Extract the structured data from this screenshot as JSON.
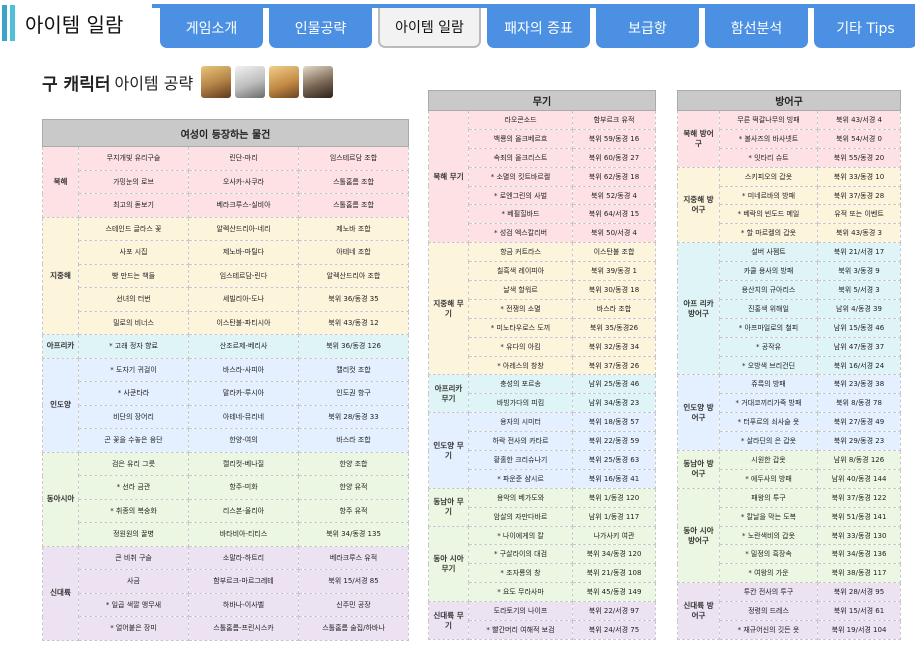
{
  "header": {
    "title": "아이템 일람"
  },
  "tabs": [
    "게임소개",
    "인물공략",
    "아이템 일람",
    "패자의 증표",
    "보급항",
    "함선분석",
    "기타 Tips"
  ],
  "active_tab": 2,
  "section": {
    "bold": "구 캐릭터",
    "normal": "아이템 공략"
  },
  "table1": {
    "header": "여성이 등장하는 물건",
    "groups": [
      {
        "cat": "북해",
        "color": "pink",
        "rows": [
          [
            "무지개빛 유리구슬",
            "린단-마리",
            "임스테르담 조합"
          ],
          [
            "가밍눈의 로브",
            "오사카-사쿠라",
            "스톨홈름 조합"
          ],
          [
            "최고의 돋보기",
            "베라크루스-실비아",
            "스톨홈름 조합"
          ]
        ]
      },
      {
        "cat": "지중해",
        "color": "yel",
        "rows": [
          [
            "스테인드 글라스 꽃",
            "알렉산드리아-네리",
            "제노바 조합"
          ],
          [
            "사포 시집",
            "제노바-마틸다",
            "아테네 조합"
          ],
          [
            "빵 만드는 책들",
            "임스테르담-린다",
            "알렉산드리아 조합"
          ],
          [
            "선녀의 터번",
            "세빌리아-도나",
            "북위 36/동경 35"
          ],
          [
            "밀로의 비너스",
            "이스탄불-파티시아",
            "북위 43/동경 12"
          ]
        ]
      },
      {
        "cat": "아프리카",
        "color": "cyan",
        "rows": [
          [
            "* 고래 정자 향료",
            "산조르제-베리사",
            "북위 36/동경 126"
          ]
        ]
      },
      {
        "cat": "인도양",
        "color": "blue",
        "rows": [
          [
            "* 도자기 귀걸이",
            "바스라-사피아",
            "캘리컷 조합"
          ],
          [
            "* 사쿤타라",
            "말라카-루시아",
            "인도권 항구"
          ],
          [
            "비단의 장어리",
            "아테네-뮤리네",
            "북위 28/동경 33"
          ],
          [
            "곤 꽃을 수놓은 융단",
            "한양-여의",
            "바스라 조합"
          ]
        ]
      },
      {
        "cat": "동아시아",
        "color": "green",
        "rows": [
          [
            "검은 유리 그릇",
            "캘리컷-베나질",
            "한양 조합"
          ],
          [
            "* 선라 금관",
            "항주-미화",
            "한양 유적"
          ],
          [
            "* 취종의 복숭화",
            "리스본-올리아",
            "항주 유적"
          ],
          [
            "정원원의 꿀병",
            "바타비아-티티스",
            "북위 34/동경 135"
          ]
        ]
      },
      {
        "cat": "신대륙",
        "color": "purple",
        "rows": [
          [
            "큰 비취 구슬",
            "소말라-하트리",
            "베라크루스 유적"
          ],
          [
            "사금",
            "함부르크-마르그레테",
            "북위 15/서경 85"
          ],
          [
            "* 일곱 색깔 앵무새",
            "하바나-이사벨",
            "신주민 공장"
          ],
          [
            "* 얼어붙은 장미",
            "스톨홈름-프린시스카",
            "스톨홈름 술집/하바나"
          ]
        ]
      }
    ]
  },
  "table2": {
    "header": "무기",
    "groups": [
      {
        "cat": "북해 무기",
        "color": "pink",
        "rows": [
          [
            "라오콘소드",
            "함부르크 유적"
          ],
          [
            "백룡의 올크베르흐",
            "북위 59/동경 16"
          ],
          [
            "속죄의 올크리스트",
            "북위 60/동경 27"
          ],
          [
            "* 소멸의 킷트바르켈",
            "북위 62/동경 18"
          ],
          [
            "* 로엔그린의 사벌",
            "북위 52/동경 4"
          ],
          [
            "* 베필힐바드",
            "북위 64/서경 15"
          ],
          [
            "* 성검 엑스칼리버",
            "북위 50/서경 4"
          ]
        ]
      },
      {
        "cat": "지중해 무기",
        "color": "yel",
        "rows": [
          [
            "항금 커트라스",
            "이스탄불 조합"
          ],
          [
            "칠흑색 레이피아",
            "북위 39/동경 1"
          ],
          [
            "날색 할워르",
            "북위 30/동경 18"
          ],
          [
            "* 전쟁의 소멸",
            "바스라 조합"
          ],
          [
            "* 미노타우로스 도끼",
            "북위 35/동경26"
          ],
          [
            "* 유다의 아킴",
            "북위 32/동경 34"
          ],
          [
            "* 아레스의 창창",
            "북위 37/동경 26"
          ]
        ]
      },
      {
        "cat": "아프리카 무기",
        "color": "cyan",
        "rows": [
          [
            "충성의 포르송",
            "남위 25/동경 46"
          ],
          [
            "바빙가다의 피킴",
            "남위 34/동경 23"
          ]
        ]
      },
      {
        "cat": "인도양 무기",
        "color": "blue",
        "rows": [
          [
            "용자의 시미터",
            "북위 18/동경 57"
          ],
          [
            "하락 전사의 카타르",
            "북위 22/동경 59"
          ],
          [
            "황홀한 크리슈나기",
            "북위 25/동경 63"
          ],
          [
            "* 파운준 샴시르",
            "북위 16/동경 41"
          ]
        ]
      },
      {
        "cat": "동남아 무기",
        "color": "green",
        "rows": [
          [
            "용악의 베가도와",
            "북위 1/동경 120"
          ],
          [
            "암살의 자만다바르",
            "남위 1/동경 117"
          ]
        ]
      },
      {
        "cat": "동아 시아 무기",
        "color": "green",
        "rows": [
          [
            "* 나이에게의 칼",
            "나가사키 여관"
          ],
          [
            "* 구살라이의 대검",
            "북위 34/동경 120"
          ],
          [
            "* 조자룡의 창",
            "북위 21/동경 108"
          ],
          [
            "* 요도 무라사마",
            "북위 45/동경 149"
          ]
        ]
      },
      {
        "cat": "신대륙 무기",
        "color": "purple",
        "rows": [
          [
            "도라토기의 나이프",
            "북위 22/서경 97"
          ],
          [
            "* 빨간머리 여해적 보검",
            "북위 24/서경 75"
          ]
        ]
      }
    ]
  },
  "table3": {
    "header": "방어구",
    "groups": [
      {
        "cat": "북해 방어구",
        "color": "pink",
        "rows": [
          [
            "무른 떡갈나무의 빙패",
            "북위 43/서경 4"
          ],
          [
            "* 볼사즈의 바사넷트",
            "북위 54/서경 0"
          ],
          [
            "* 잇타리 슈트",
            "북위 55/동경 20"
          ]
        ]
      },
      {
        "cat": "지중해 방어구",
        "color": "yel",
        "rows": [
          [
            "스키피오의 갑옷",
            "북위 33/동경 10"
          ],
          [
            "* 미네르바의 방패",
            "북위 37/동경 28"
          ],
          [
            "* 베락의 빈도드 메일",
            "유적 또는 이벤트"
          ],
          [
            "* 할 마르켈의 갑옷",
            "북위 43/동경 3"
          ]
        ]
      },
      {
        "cat": "아프 리카 방어구",
        "color": "cyan",
        "rows": [
          [
            "설버 사젬트",
            "북위 21/서경 17"
          ],
          [
            "카쿨 용사의 방패",
            "북위 3/동경 9"
          ],
          [
            "용산치의 규아리스",
            "북위 5/서경 3"
          ],
          [
            "진홍색 위해일",
            "남위 4/동경 39"
          ],
          [
            "* 아프마일로의 철피",
            "남위 15/동경 46"
          ],
          [
            "* 공작유",
            "남위 47/동경 37"
          ],
          [
            "* 오방색 브리건딘",
            "북위 16/서경 24"
          ]
        ]
      },
      {
        "cat": "인도양 방어구",
        "color": "blue",
        "rows": [
          [
            "쥬륵의 방패",
            "북위 23/동경 38"
          ],
          [
            "* 거대코끼리가죽 방패",
            "북위 8/동경 78"
          ],
          [
            "* 터푸르의 쇠사슬 옷",
            "북위 27/동경 49"
          ],
          [
            "* 살라딘의 은 갑옷",
            "북위 29/동경 23"
          ]
        ]
      },
      {
        "cat": "동남아 방어구",
        "color": "green",
        "rows": [
          [
            "시원한 갑옷",
            "남위 8/동경 126"
          ],
          [
            "* 에두사의 방패",
            "남위 40/동경 144"
          ]
        ]
      },
      {
        "cat": "동아 시아 방어구",
        "color": "green",
        "rows": [
          [
            "패왕의 투구",
            "북위 37/동경 122"
          ],
          [
            "* 칼날을 막는 도복",
            "북위 51/동경 141"
          ],
          [
            "* 노란색비의 갑옷",
            "북위 33/동경 130"
          ],
          [
            "* 밀정의 흑장속",
            "북위 34/동경 136"
          ],
          [
            "* 여왕의 가운",
            "북위 38/동경 117"
          ]
        ]
      },
      {
        "cat": "신대륙 방어구",
        "color": "purple",
        "rows": [
          [
            "투칸 전사의 투구",
            "북위 28/서경 95"
          ],
          [
            "정령의 드레스",
            "북위 15/서경 61"
          ],
          [
            "* 재규어신의 깃든 옷",
            "북위 19/서경 104"
          ]
        ]
      }
    ]
  }
}
